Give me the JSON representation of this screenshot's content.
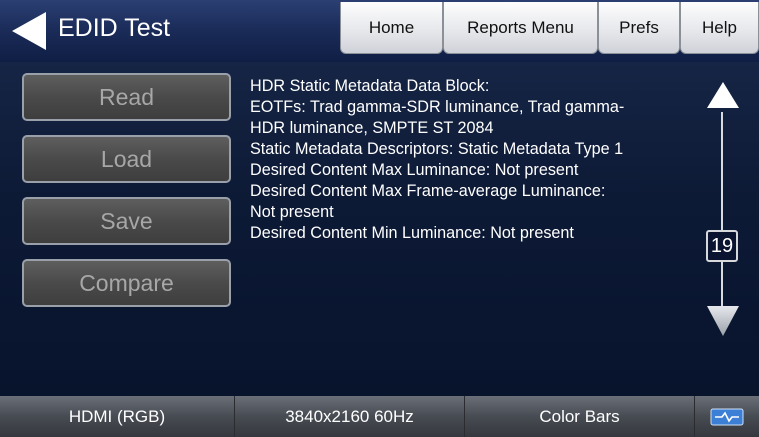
{
  "header": {
    "title": "EDID Test",
    "tabs": [
      {
        "label": "Home"
      },
      {
        "label": "Reports Menu"
      },
      {
        "label": "Prefs"
      },
      {
        "label": "Help"
      }
    ]
  },
  "sidebar": {
    "buttons": [
      {
        "label": "Read"
      },
      {
        "label": "Load"
      },
      {
        "label": "Save"
      },
      {
        "label": "Compare"
      }
    ]
  },
  "content": {
    "lines": [
      "HDR Static Metadata Data Block:",
      "EOTFs: Trad gamma-SDR luminance, Trad gamma-",
      "HDR luminance, SMPTE ST 2084",
      "Static Metadata Descriptors: Static Metadata Type 1",
      "Desired Content Max Luminance: Not present",
      "Desired Content Max Frame-average Luminance:",
      "Not present",
      "Desired Content Min Luminance: Not present"
    ]
  },
  "scroll": {
    "page": "19"
  },
  "status_bar": {
    "interface": "HDMI (RGB)",
    "resolution": "3840x2160 60Hz",
    "pattern": "Color Bars",
    "icon": "connection-icon"
  },
  "colors": {
    "background": "#0d1a36",
    "button": "#4a4a4a",
    "button_text": "#a7a7a7",
    "status_icon": "#3b7fd6"
  }
}
